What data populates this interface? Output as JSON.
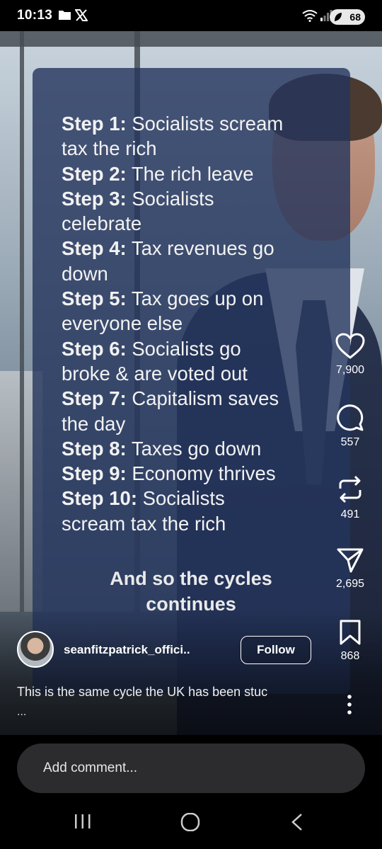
{
  "status_bar": {
    "time": "10:13",
    "icons": [
      "folder-icon",
      "x-logo-icon",
      "wifi-icon",
      "signal-icon"
    ],
    "battery": "68"
  },
  "post": {
    "steps": [
      {
        "label": "Step 1:",
        "text_lines": [
          "Socialists scream",
          "tax the rich"
        ]
      },
      {
        "label": "Step 2:",
        "text_lines": [
          "The rich leave"
        ]
      },
      {
        "label": "Step 3:",
        "text_lines": [
          "Socialists",
          "celebrate"
        ]
      },
      {
        "label": "Step 4:",
        "text_lines": [
          "Tax revenues go",
          "down"
        ]
      },
      {
        "label": "Step 5:",
        "text_lines": [
          "Tax goes up on",
          "everyone else"
        ]
      },
      {
        "label": "Step 6:",
        "text_lines": [
          "Socialists go",
          "broke & are voted out"
        ]
      },
      {
        "label": "Step 7:",
        "text_lines": [
          "Capitalism saves",
          "the day"
        ]
      },
      {
        "label": "Step 8:",
        "text_lines": [
          "Taxes go down"
        ]
      },
      {
        "label": "Step 9:",
        "text_lines": [
          "Economy thrives"
        ]
      },
      {
        "label": "Step 10:",
        "text_lines": [
          "Socialists",
          "scream tax the rich"
        ]
      }
    ],
    "closing_lines": [
      "And so the cycles",
      "continues"
    ]
  },
  "actions": {
    "like_count": "7,900",
    "comment_count": "557",
    "repost_count": "491",
    "share_count": "2,695",
    "save_count": "868"
  },
  "author": {
    "username": "seanfitzpatrick_offici..",
    "follow_label": "Follow"
  },
  "caption": {
    "text": "This is the same cycle the UK has been stuc",
    "more": "..."
  },
  "comment": {
    "placeholder": "Add comment..."
  },
  "colors": {
    "overlay": "#24345c",
    "background": "#000000",
    "comment_box": "#2c2c2e"
  }
}
